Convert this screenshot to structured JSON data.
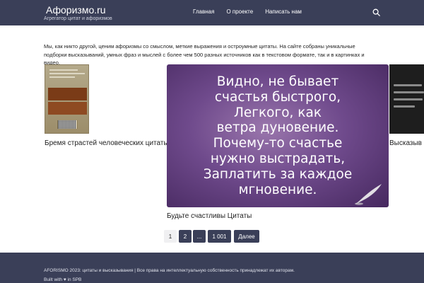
{
  "header": {
    "brand_icon": "",
    "brand_title": "Афоризмо.ru",
    "tagline": "Агрегатор цитат и афоризмов",
    "nav": [
      "Главная",
      "О проекте",
      "Написать нам"
    ],
    "search_icon": "search-icon"
  },
  "intro": "Мы, как никто другой, ценим афоризмы со смыслом, меткие выражения и остроумные цитаты. На сайте собраны уникальные подборки высказываний, умных фраз и мыслей с более чем 500 разных источников как в текстовом формате, так и в картинках и видео.",
  "cards": {
    "left_title": "Бремя страстей человеческих цитаты",
    "center_title": "Будьте счастливы Цитаты",
    "right_title": "Высказыв",
    "quote_lines": [
      "Видно, не бывает",
      "счастья быстрого,",
      "Легкого, как",
      "ветра дуновение.",
      "Почему-то счастье",
      "нужно выстрадать,",
      "Заплатить за каждое",
      "мгновение."
    ]
  },
  "pagination": [
    "1",
    "2",
    "...",
    "1 001",
    "Далее"
  ],
  "footer": {
    "line1": "AFORISMO 2023: цитаты и высказывания | Все права на интеллектуальную собственность принадлежат их авторам.",
    "line2_prefix": "Built with",
    "heart": "♥",
    "line2_suffix": "in SPB"
  },
  "colors": {
    "header_bg": "#3a3f58",
    "accent": "#3a3f58"
  }
}
